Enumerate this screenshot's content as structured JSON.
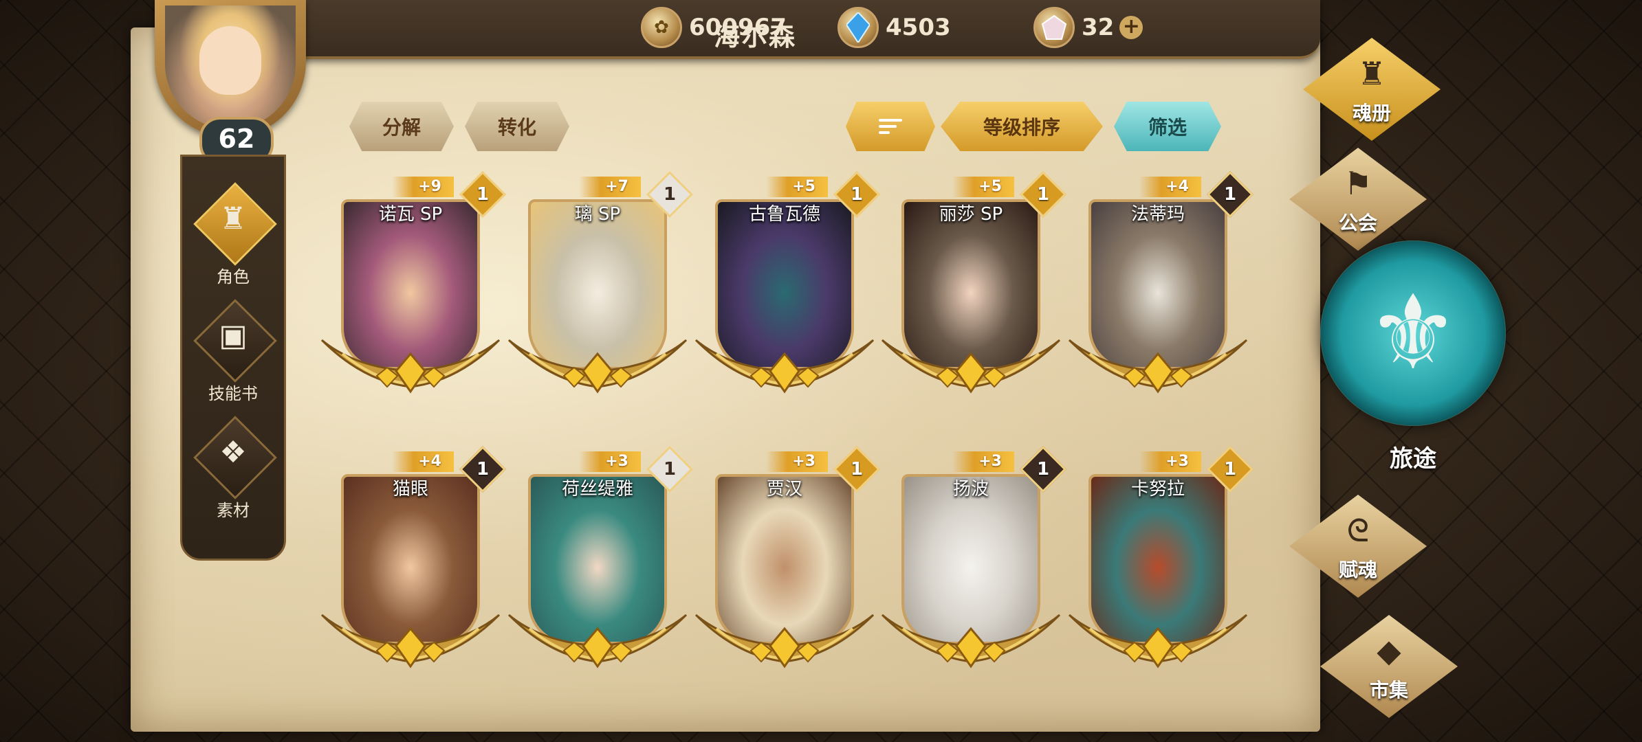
{
  "player": {
    "name": "海尔森",
    "level": "62"
  },
  "resources": {
    "gold": {
      "icon": "gold-coin-icon",
      "value": "600967"
    },
    "crystal": {
      "icon": "blue-crystal-icon",
      "value": "4503"
    },
    "gem": {
      "icon": "gem-icon",
      "value": "32",
      "plus": "+"
    }
  },
  "left_nav": [
    {
      "label": "角色",
      "icon": "helmet-icon",
      "active": true
    },
    {
      "label": "技能书",
      "icon": "book-icon",
      "active": false
    },
    {
      "label": "素材",
      "icon": "material-icon",
      "active": false
    }
  ],
  "actions": {
    "decompose": "分解",
    "convert": "转化",
    "level_sort": "等级排序",
    "filter": "筛选"
  },
  "cards": [
    {
      "name": "诺瓦 SP",
      "plus": "+9",
      "stars": "1",
      "star_style": "gold",
      "colors": [
        "#a35a7a",
        "#f0c8a0",
        "#3a2a30"
      ]
    },
    {
      "name": "璃 SP",
      "plus": "+7",
      "stars": "1",
      "star_style": "white",
      "colors": [
        "#c8c0a8",
        "#f4ece0",
        "#e8c478"
      ]
    },
    {
      "name": "古鲁瓦德",
      "plus": "+5",
      "stars": "1",
      "star_style": "gold",
      "colors": [
        "#4a3a6a",
        "#2a6a70",
        "#1a1a22"
      ]
    },
    {
      "name": "丽莎 SP",
      "plus": "+5",
      "stars": "1",
      "star_style": "gold",
      "colors": [
        "#6a5a4a",
        "#f2d4c0",
        "#2a1a14"
      ]
    },
    {
      "name": "法蒂玛",
      "plus": "+4",
      "stars": "1",
      "star_style": "dark",
      "colors": [
        "#8a7a68",
        "#e8e4da",
        "#4a4040"
      ]
    },
    {
      "name": "猫眼",
      "plus": "+4",
      "stars": "1",
      "star_style": "dark",
      "colors": [
        "#8a5a3a",
        "#f0c8a0",
        "#5a3020"
      ]
    },
    {
      "name": "荷丝缇雅",
      "plus": "+3",
      "stars": "1",
      "star_style": "white",
      "colors": [
        "#3a8a80",
        "#f2d8c4",
        "#2a5a58"
      ]
    },
    {
      "name": "贾汉",
      "plus": "+3",
      "stars": "1",
      "star_style": "gold",
      "colors": [
        "#e8d8b8",
        "#c0906a",
        "#6a4a30"
      ]
    },
    {
      "name": "扬波",
      "plus": "+3",
      "stars": "1",
      "star_style": "dark",
      "colors": [
        "#d8d4cc",
        "#f4f2ee",
        "#9a9288"
      ]
    },
    {
      "name": "卡努拉",
      "plus": "+3",
      "stars": "1",
      "star_style": "gold",
      "colors": [
        "#3a7a78",
        "#b84a2a",
        "#6a2a18"
      ]
    }
  ],
  "right_nav": [
    {
      "label": "魂册",
      "icon": "helmet-icon",
      "active": true
    },
    {
      "label": "公会",
      "icon": "guild-banner-icon",
      "active": false
    },
    {
      "label": "赋魂",
      "icon": "swirl-icon",
      "active": false
    },
    {
      "label": "市集",
      "icon": "gem-market-icon",
      "active": false
    }
  ],
  "journey": {
    "label": "旅途",
    "icon": "trident-emblem-icon"
  }
}
